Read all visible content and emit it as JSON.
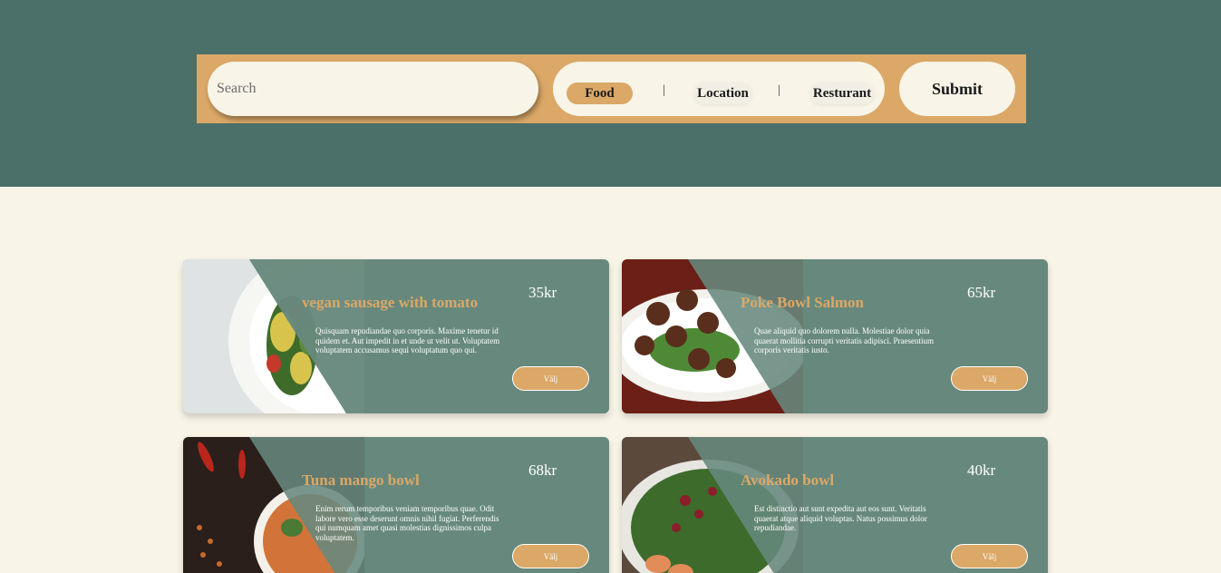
{
  "search": {
    "placeholder": "Search"
  },
  "filters": [
    {
      "label": "Food",
      "active": true
    },
    {
      "label": "Location",
      "active": false
    },
    {
      "label": "Resturant",
      "active": false
    }
  ],
  "separator": "|",
  "submit_label": "Submit",
  "colors": {
    "header_bg": "#4a7069",
    "bar_bg": "#dba867",
    "page_bg": "#f8f4e7",
    "card_bg": "#67897d",
    "accent": "#dba867"
  },
  "cards": [
    {
      "title": "vegan sausage with tomato",
      "price": "35kr",
      "description": "Quisquam repudiandae quo corporis. Maxime tenetur id quidem et. Aut impedit in et unde ut velit ut. Voluptatem voluptatem accusamus sequi voluptatum quo qui.",
      "button": "Välj",
      "image": "pasta-salad-plate"
    },
    {
      "title": "Poke Bowl Salmon",
      "price": "65kr",
      "description": "Quae aliquid quo dolorem nulla. Molestiae dolor quia quaerat mollitia corrupti veritatis adipisci. Praesentium corporis veritatis iusto.",
      "button": "Välj",
      "image": "meatballs-plate"
    },
    {
      "title": "Tuna mango bowl",
      "price": "68kr",
      "description": "Enim rerum temporibus veniam temporibus quae. Odit labore vero esse deserunt omnis nihil fugiat. Perferendis qui numquam amet quasi molestias dignissimos culpa voluptatem.",
      "button": "Välj",
      "image": "curry-bowl"
    },
    {
      "title": "Avokado bowl",
      "price": "40kr",
      "description": "Est distinctio aut sunt expedita aut eos sunt. Veritatis quaerat atque aliquid voluptas. Natus possimus dolor repudiandae.",
      "button": "Välj",
      "image": "salad-bowl"
    }
  ]
}
